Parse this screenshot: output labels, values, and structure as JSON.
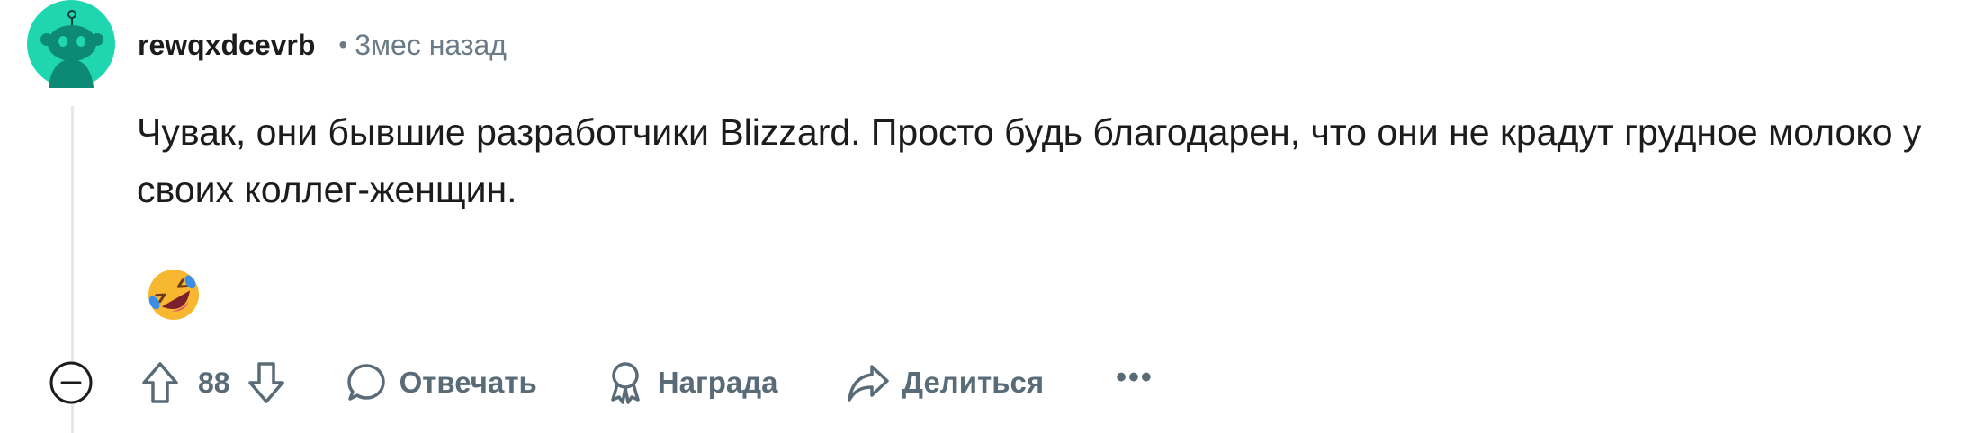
{
  "comment": {
    "author": "rewqxdcevrb",
    "separator": "•",
    "time": "3мес назад",
    "text": "Чувак, они бывшие разработчики Blizzard. Просто будь благодарен, что они не крадут грудное молоко у своих коллег-женщин.",
    "avatar_icon": "reddit-snoo-avatar",
    "avatar_color": "#1fd6b0",
    "reaction_icon": "rolling-on-floor-laughing-emoji"
  },
  "actions": {
    "collapse_icon": "collapse-minus-icon",
    "upvote_icon": "upvote-arrow-icon",
    "score": "88",
    "downvote_icon": "downvote-arrow-icon",
    "reply_label": "Отвечать",
    "award_label": "Награда",
    "share_label": "Делиться",
    "more_label": "•••"
  },
  "colors": {
    "text": "#1c1c1c",
    "muted": "#5a6b78",
    "thread_line": "#e5e8ea"
  }
}
